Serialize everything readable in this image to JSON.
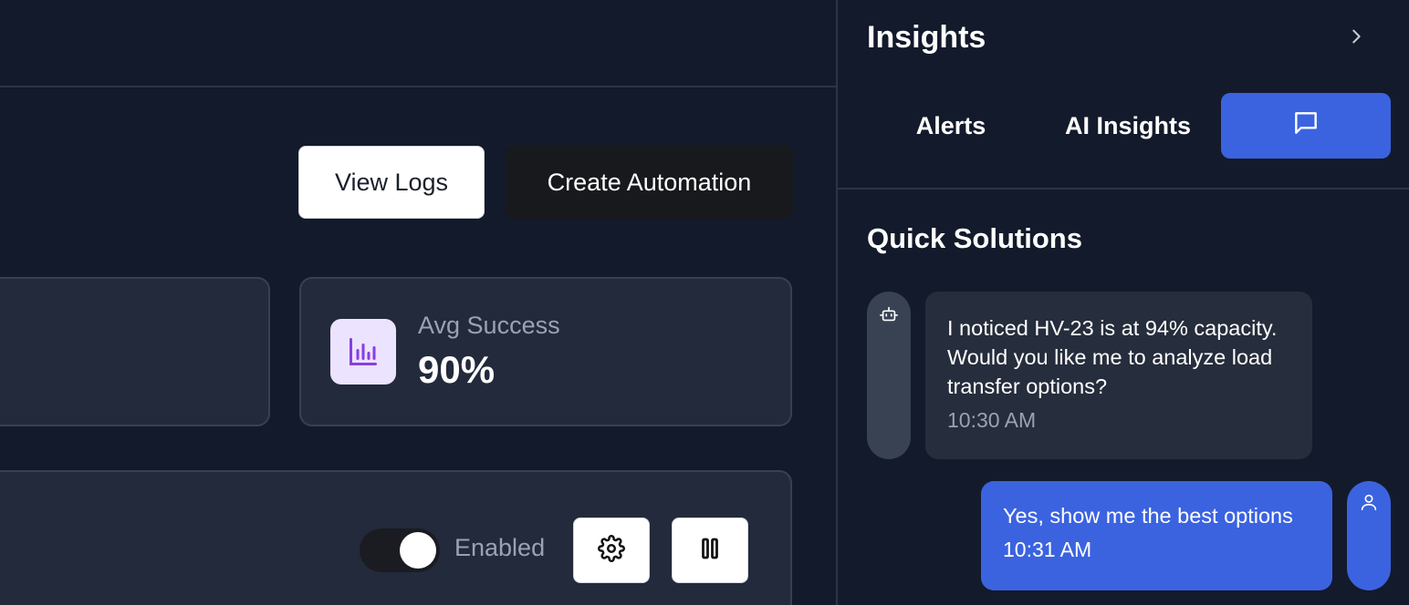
{
  "header": {
    "view_logs_label": "View Logs",
    "create_automation_label": "Create Automation"
  },
  "stats": {
    "avg_success": {
      "label": "Avg Success",
      "value": "90%",
      "icon": "bar-chart-icon"
    }
  },
  "automation": {
    "toggle_label": "Enabled",
    "enabled": true,
    "settings_icon": "gear-icon",
    "pause_icon": "pause-icon"
  },
  "insights": {
    "title": "Insights",
    "collapse_icon": "chevron-right-icon",
    "tabs": [
      {
        "label": "Alerts"
      },
      {
        "label": "AI Insights"
      },
      {
        "label": "",
        "icon": "chat-icon",
        "active": true
      }
    ],
    "section_title": "Quick Solutions",
    "messages": [
      {
        "sender": "bot",
        "avatar_icon": "bot-icon",
        "text": "I noticed HV-23 is at 94% capacity. Would you like me to analyze load transfer options?",
        "time": "10:30 AM"
      },
      {
        "sender": "user",
        "avatar_icon": "user-icon",
        "text": "Yes, show me the best options",
        "time": "10:31 AM"
      }
    ]
  },
  "colors": {
    "background": "#131a2b",
    "card": "#222a3b",
    "accent": "#3b63e0",
    "muted_text": "#9aa3b2",
    "stat_icon_bg": "#ece3ff",
    "stat_icon_fg": "#8a3ee0"
  }
}
